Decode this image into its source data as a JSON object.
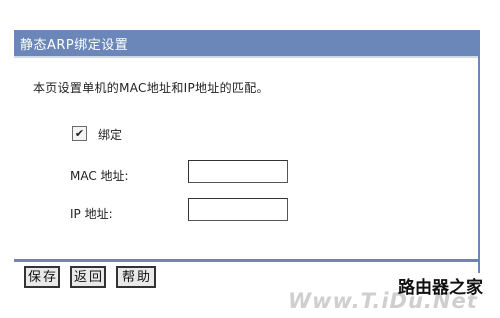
{
  "panel": {
    "title": "静态ARP绑定设置",
    "description": "本页设置单机的MAC地址和IP地址的匹配。"
  },
  "form": {
    "bind_checkbox": {
      "checked": true,
      "label": "绑定"
    },
    "mac": {
      "label": "MAC 地址:",
      "value": ""
    },
    "ip": {
      "label": "IP 地址:",
      "value": ""
    }
  },
  "buttons": {
    "save": "保存",
    "back": "返回",
    "help": "帮助"
  },
  "watermark": {
    "brand": "路由器之家",
    "url": "Www.T.iDu.Net"
  },
  "colors": {
    "title_bar": "#6b87b9",
    "title_text": "#ffffff",
    "background": "#ffffff"
  }
}
